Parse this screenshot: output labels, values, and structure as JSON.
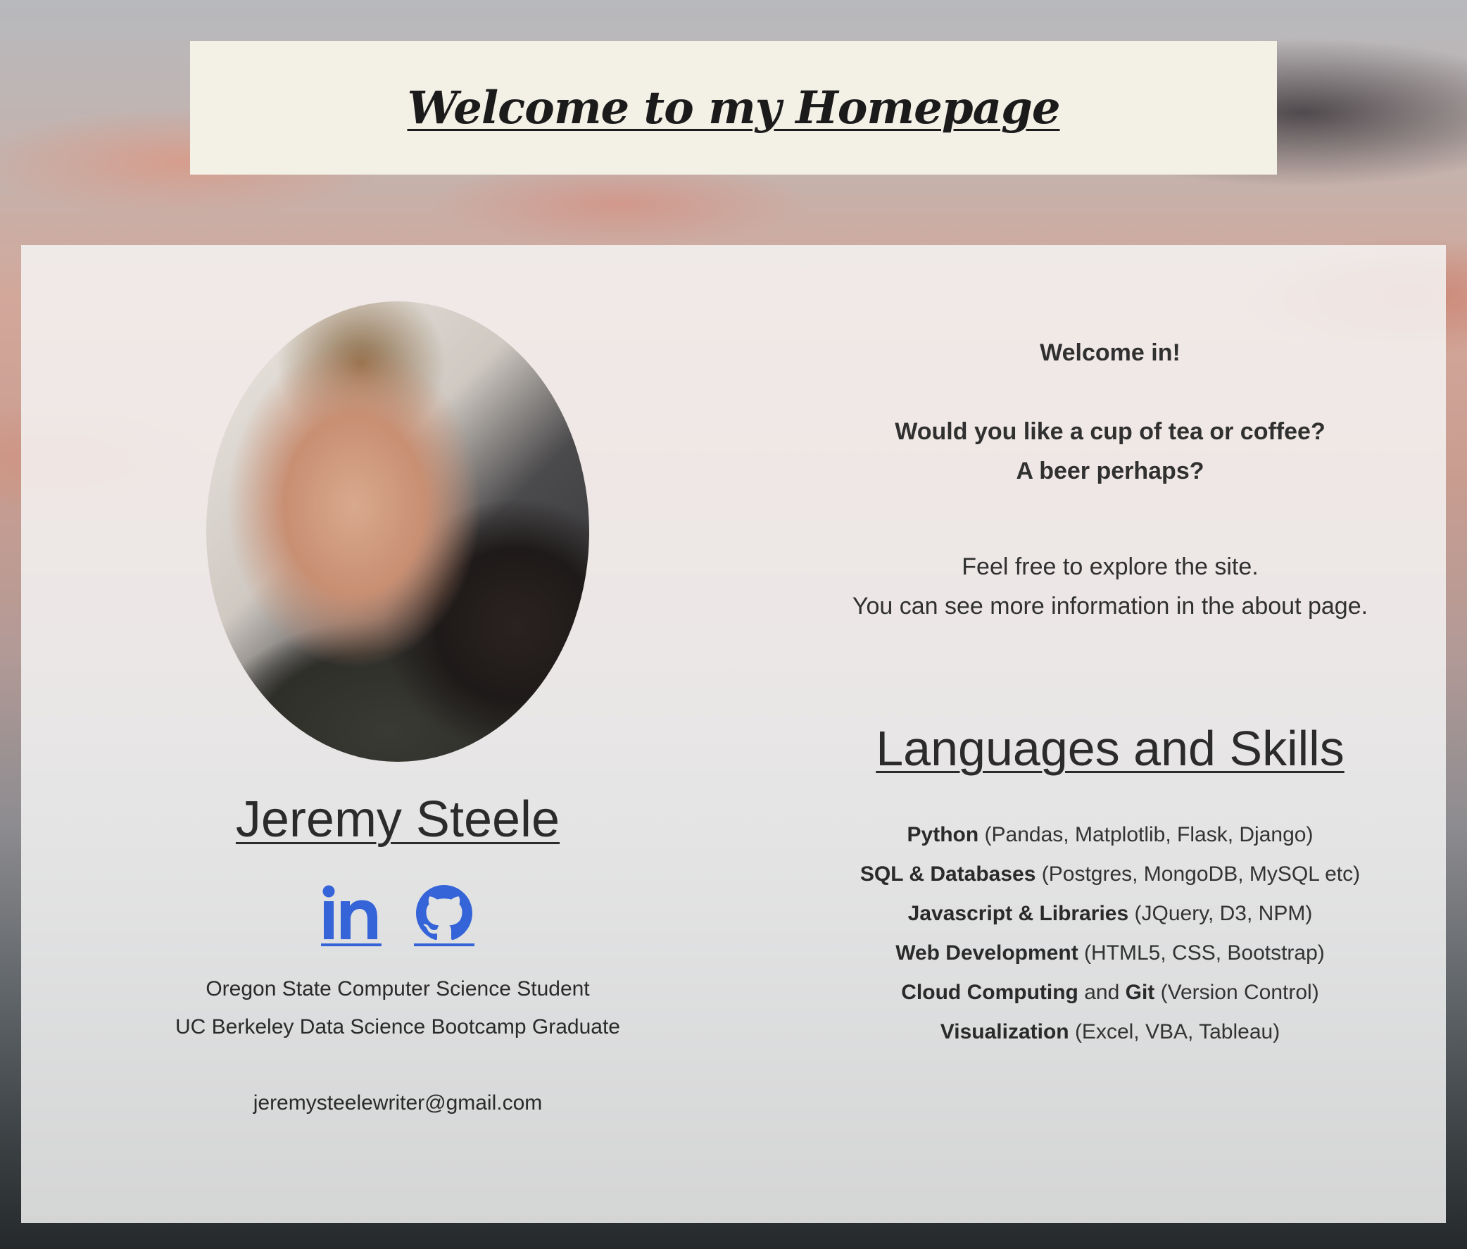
{
  "header": {
    "title": "Welcome to my Homepage"
  },
  "profile": {
    "name": "Jeremy Steele",
    "social": [
      {
        "icon": "linkedin-icon",
        "color": "#3464d8"
      },
      {
        "icon": "github-icon",
        "color": "#3464d8"
      }
    ],
    "line1": "Oregon State Computer Science Student",
    "line2": "UC Berkeley Data Science Bootcamp Graduate",
    "email": "jeremysteelewriter@gmail.com"
  },
  "welcome": {
    "greeting": "Welcome in!",
    "question1": "Would you like a cup of tea or coffee?",
    "question2": "A beer perhaps?",
    "explore1": "Feel free to explore the site.",
    "explore2": "You can see more information in the about page."
  },
  "skills": {
    "title": "Languages and Skills",
    "items": [
      {
        "name": "Python",
        "detail": " (Pandas, Matplotlib, Flask, Django)"
      },
      {
        "name": "SQL & Databases",
        "detail": " (Postgres, MongoDB, MySQL etc)"
      },
      {
        "name": "Javascript & Libraries",
        "detail": " (JQuery, D3, NPM)"
      },
      {
        "name": "Web Development",
        "detail": " (HTML5, CSS, Bootstrap)"
      },
      {
        "name": "Cloud Computing",
        "connector": " and ",
        "name2": "Git",
        "detail": " (Version Control)"
      },
      {
        "name": "Visualization",
        "detail": " (Excel, VBA, Tableau)"
      }
    ]
  },
  "colors": {
    "link_blue": "#3464d8",
    "banner": "#f3f0e6",
    "text": "#2d2d2d"
  }
}
